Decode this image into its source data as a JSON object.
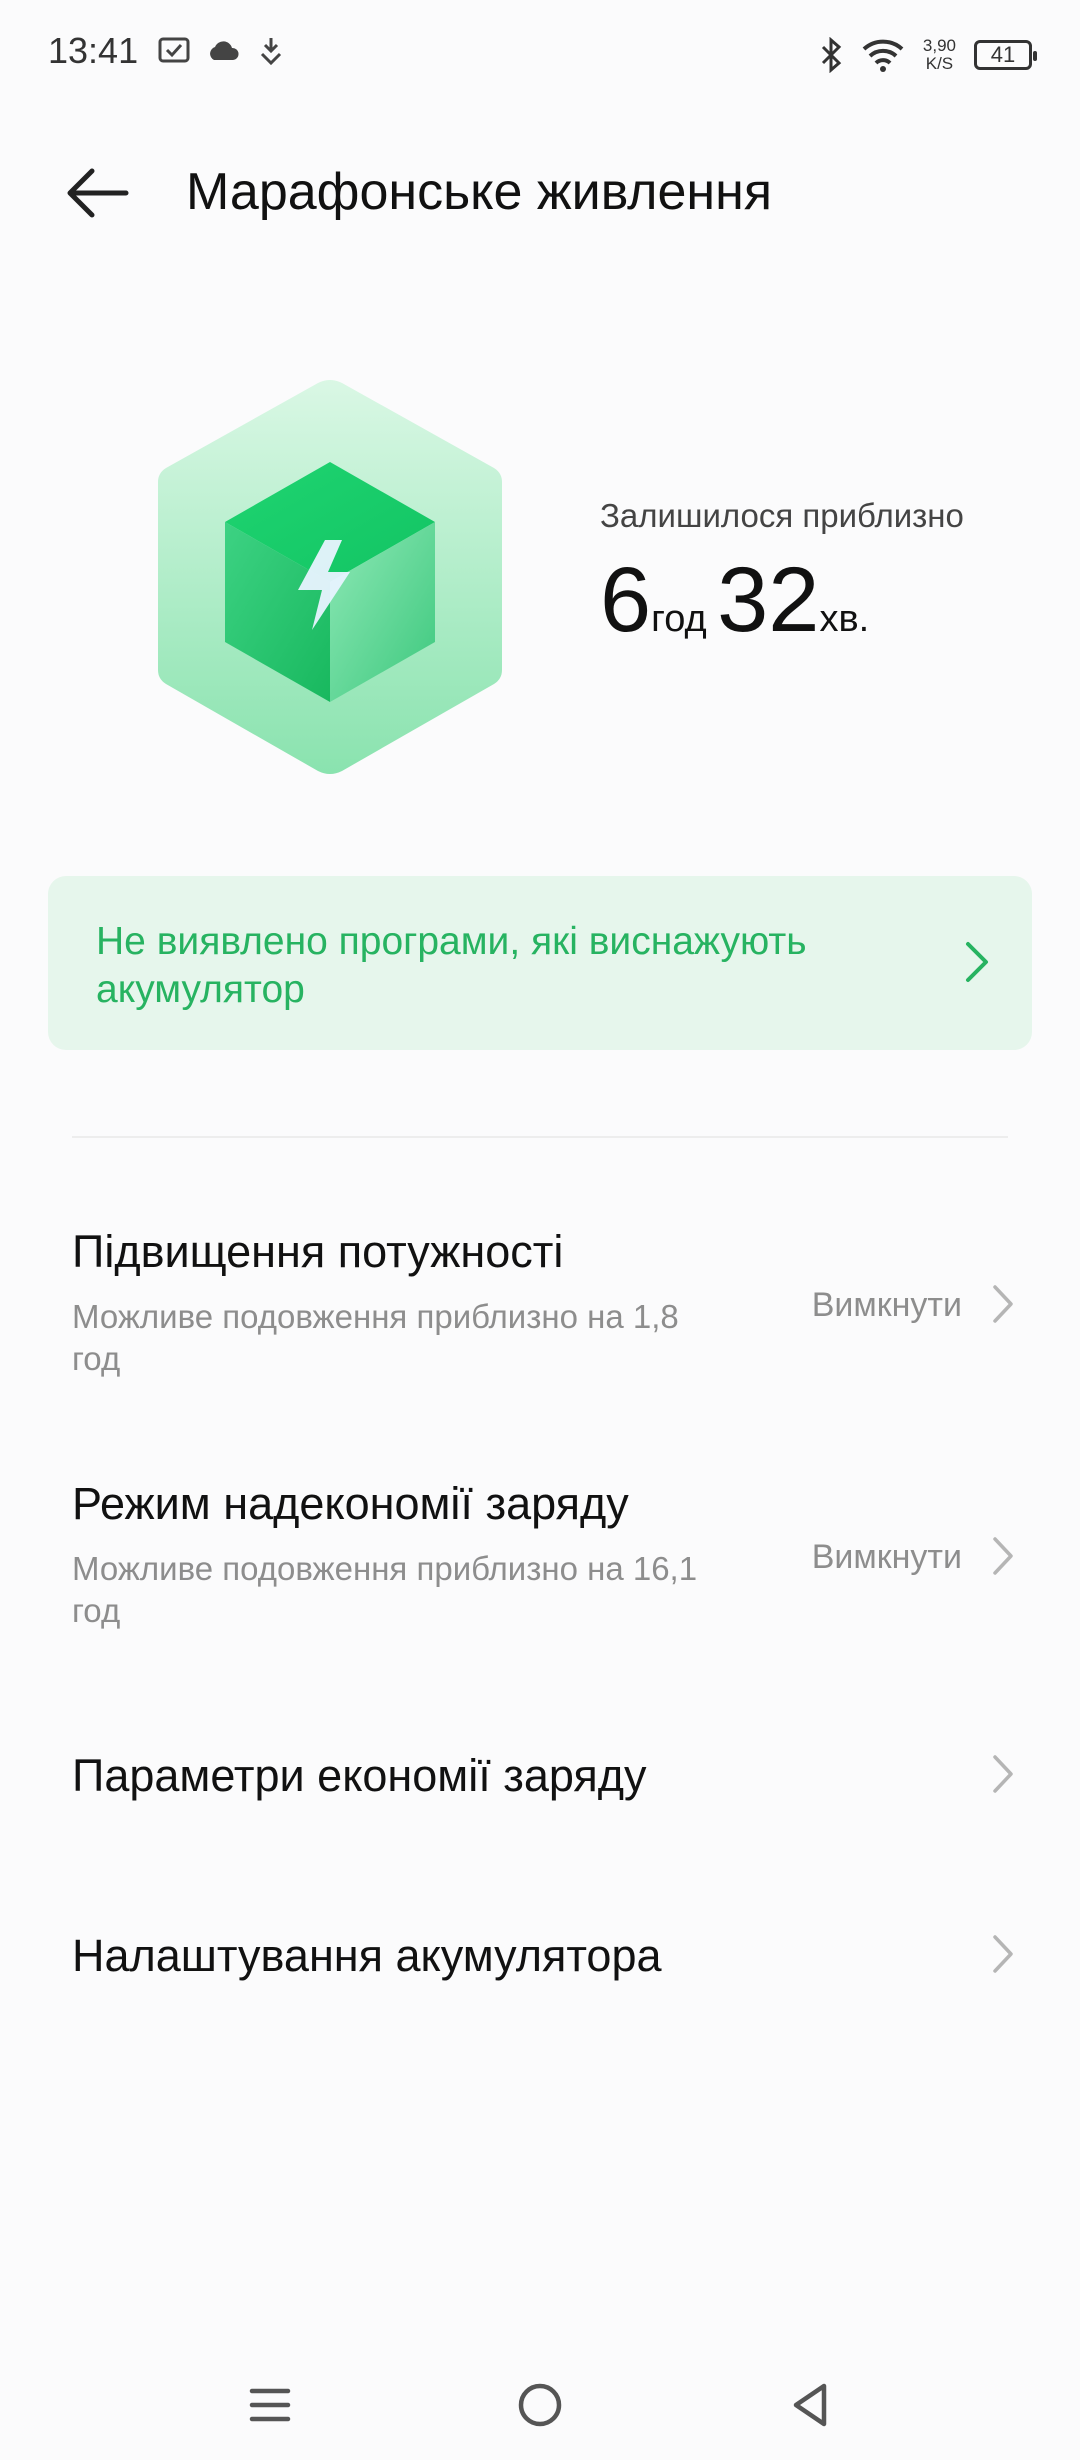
{
  "status_bar": {
    "time": "13:41",
    "icons": [
      "check-notification-icon",
      "cloud-icon",
      "download-icon",
      "bluetooth-icon",
      "wifi-icon"
    ],
    "speed_value": "3,90",
    "speed_unit": "K/S",
    "battery": "41"
  },
  "header": {
    "title": "Марафонське живлення",
    "back_icon": "arrow-left-icon"
  },
  "hero": {
    "remaining_label": "Залишилося приблизно",
    "hours": "6",
    "hours_unit": "год",
    "minutes": "32",
    "minutes_unit": "хв.",
    "icon": "battery-cube-lightning-icon"
  },
  "banner": {
    "text": "Не виявлено програми, які виснажують акумулятор",
    "color": "#27b361",
    "background": "#e6f6ec"
  },
  "settings": [
    {
      "title": "Підвищення потужності",
      "subtitle": "Можливе подовження приблизно на 1,8 год",
      "value": "Вимкнути"
    },
    {
      "title": "Режим надекономії заряду",
      "subtitle": "Можливе подовження приблизно на 16,1 год",
      "value": "Вимкнути"
    },
    {
      "title": "Параметри економії заряду"
    },
    {
      "title": "Налаштування акумулятора"
    }
  ],
  "nav_bar": {
    "items": [
      "menu-icon",
      "home-icon",
      "back-triangle-icon"
    ]
  }
}
